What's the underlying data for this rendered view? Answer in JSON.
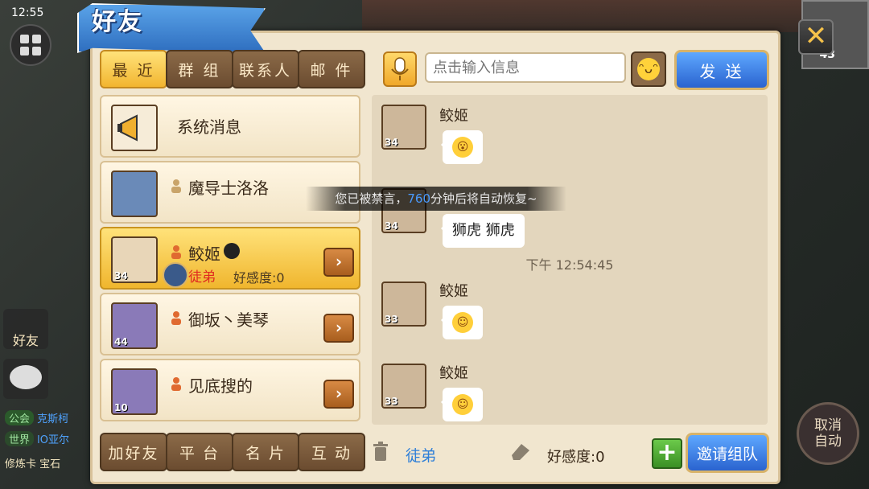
{
  "status": {
    "time": "12:55"
  },
  "hud": {
    "level": "43",
    "cancel_auto": "取消自动"
  },
  "side": {
    "friends": "好友"
  },
  "channels": {
    "guild_tag": "公会",
    "guild_text": "克斯柯",
    "world_tag": "世界",
    "world_text": "lO亚尔",
    "row3_a": "修炼卡",
    "row3_b": "宝石"
  },
  "panel": {
    "title": "好友"
  },
  "tabs": [
    "最 近",
    "群 组",
    "联系人",
    "邮 件"
  ],
  "chat_input": {
    "placeholder": "点击输入信息",
    "send": "发 送"
  },
  "friends": [
    {
      "name": "系统消息"
    },
    {
      "name": "魔导士洛洛"
    },
    {
      "name": "鲛姬",
      "level": "34",
      "relation": "徒弟",
      "favor": "好感度:0"
    },
    {
      "name": "御坂丶美琴",
      "level": "44"
    },
    {
      "name": "见底搜的",
      "level": "10"
    }
  ],
  "messages": [
    {
      "sender": "鲛姬",
      "level": "34",
      "emoji": "😮"
    },
    {
      "sender": "鲛姬",
      "level": "34",
      "text": "狮虎 狮虎"
    },
    {
      "time": "下午 12:54:45"
    },
    {
      "sender": "鲛姬",
      "level": "33",
      "emoji": "☺"
    },
    {
      "sender": "鲛姬",
      "level": "33",
      "emoji": "☺"
    }
  ],
  "toast": {
    "prefix": "您已被禁言，",
    "minutes": "760",
    "suffix": "分钟后将自动恢复~"
  },
  "bottom": {
    "buttons": [
      "加好友",
      "平 台",
      "名 片",
      "互 动"
    ],
    "relation": "徒弟",
    "favor": "好感度:0",
    "invite": "邀请组队"
  },
  "colors": {
    "tab_active": "#f2b530",
    "send": "#2a63cf",
    "relation": "#e02a20"
  }
}
